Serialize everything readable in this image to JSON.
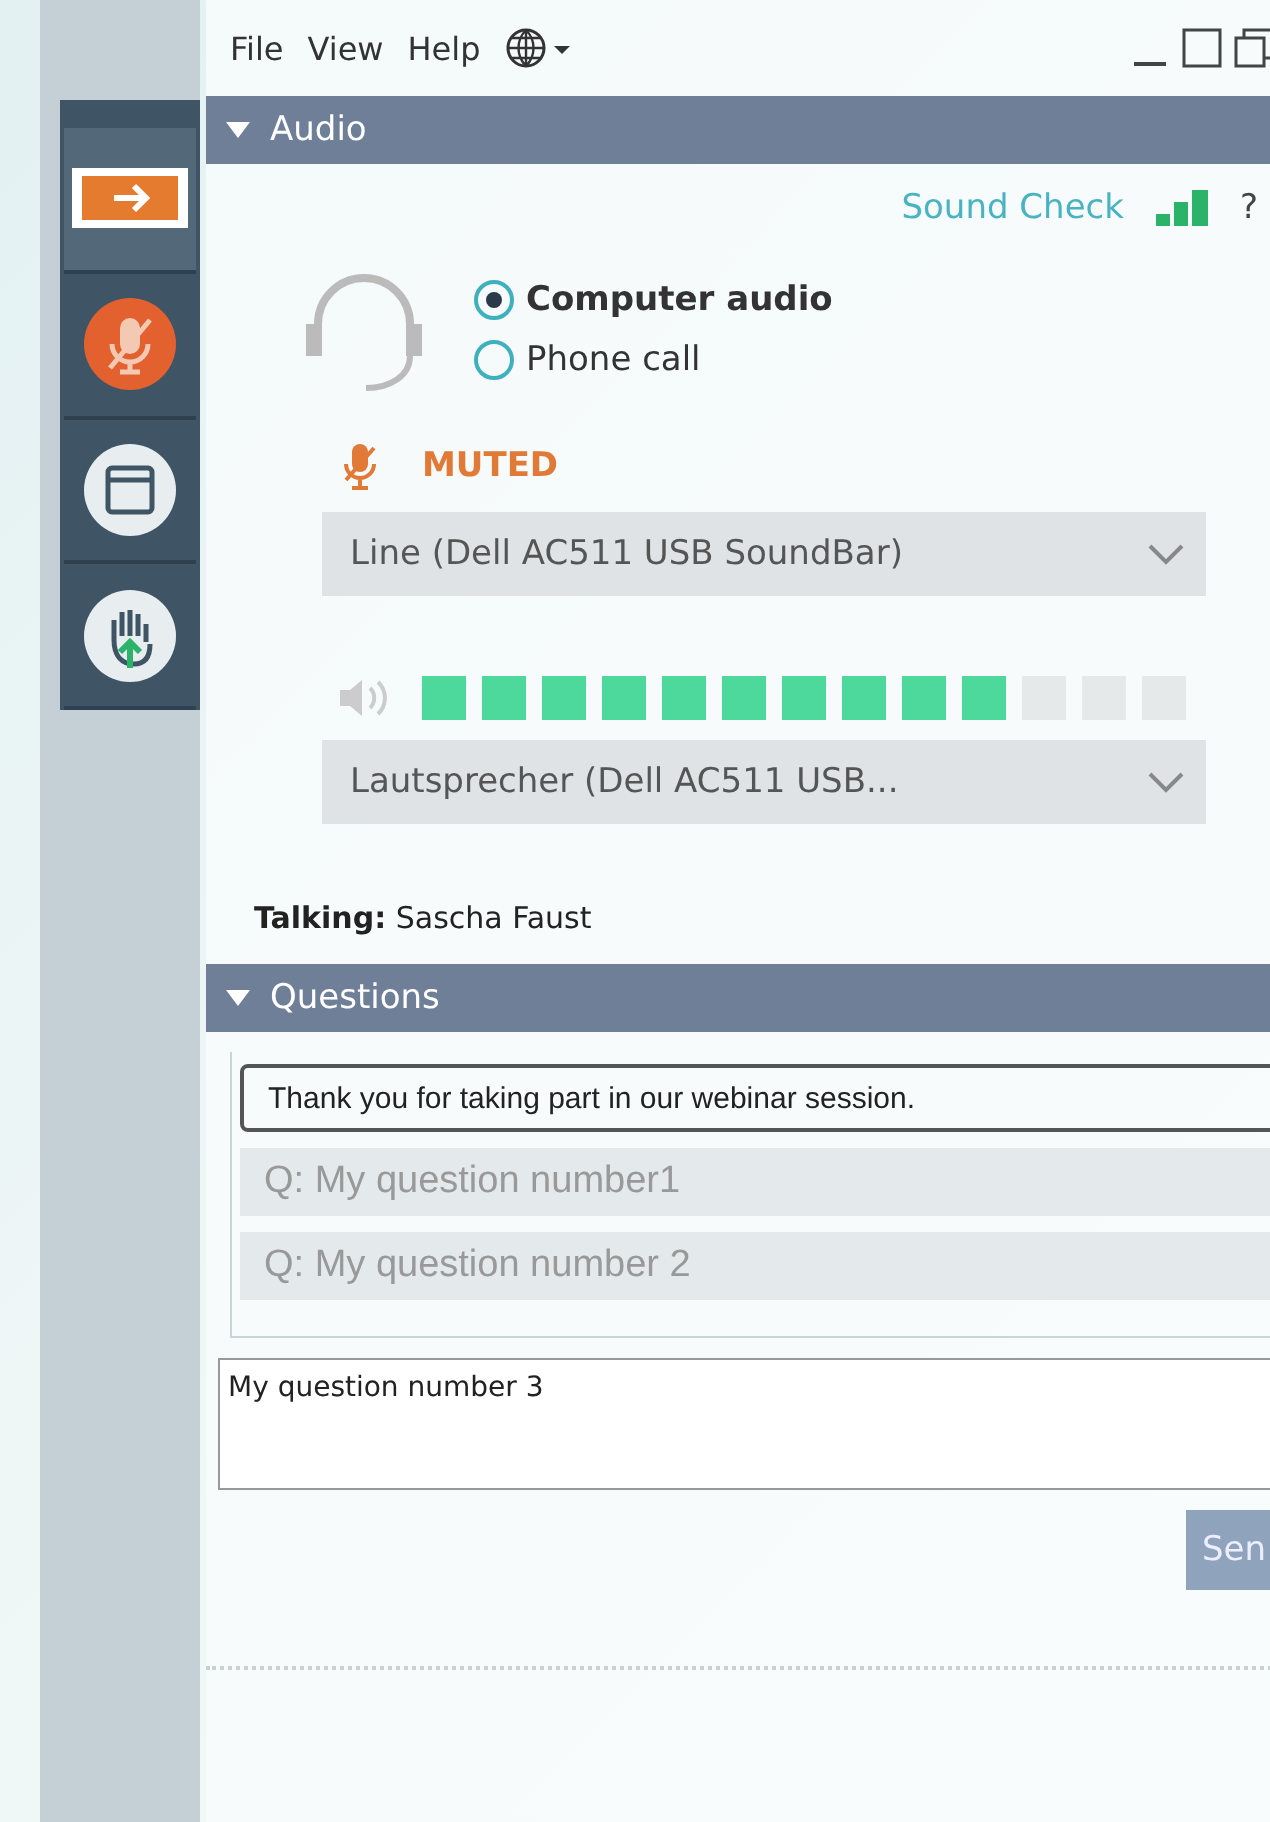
{
  "menu": [
    "File",
    "View",
    "Help"
  ],
  "sidebar": [
    {
      "selected": true
    },
    {
      "selected": false
    },
    {
      "selected": false
    },
    {
      "selected": false
    }
  ],
  "audio": {
    "title": "Audio",
    "expanded": true,
    "sound_check": "Sound Check",
    "help": "?",
    "options": [
      {
        "label": "Computer audio",
        "selected": true
      },
      {
        "label": "Phone call",
        "selected": false
      }
    ],
    "mic_status": "MUTED",
    "mic_device": "Line (Dell AC511 USB SoundBar)",
    "speaker_meter": {
      "level": 0.77
    },
    "speaker_device": "Lautsprecher (Dell AC511 USB...",
    "talking": "**Talking:** Sascha Faust"
  },
  "questions": {
    "title": "Questions",
    "expanded": true,
    "items": [
      {
        "kind": "message",
        "text": "Thank you for taking part in our webinar session."
      },
      {
        "kind": "question",
        "text": "Q: My question number1"
      },
      {
        "kind": "question",
        "text": "Q: My question number 2"
      }
    ],
    "input": "My question number 3",
    "send": "Sen"
  }
}
